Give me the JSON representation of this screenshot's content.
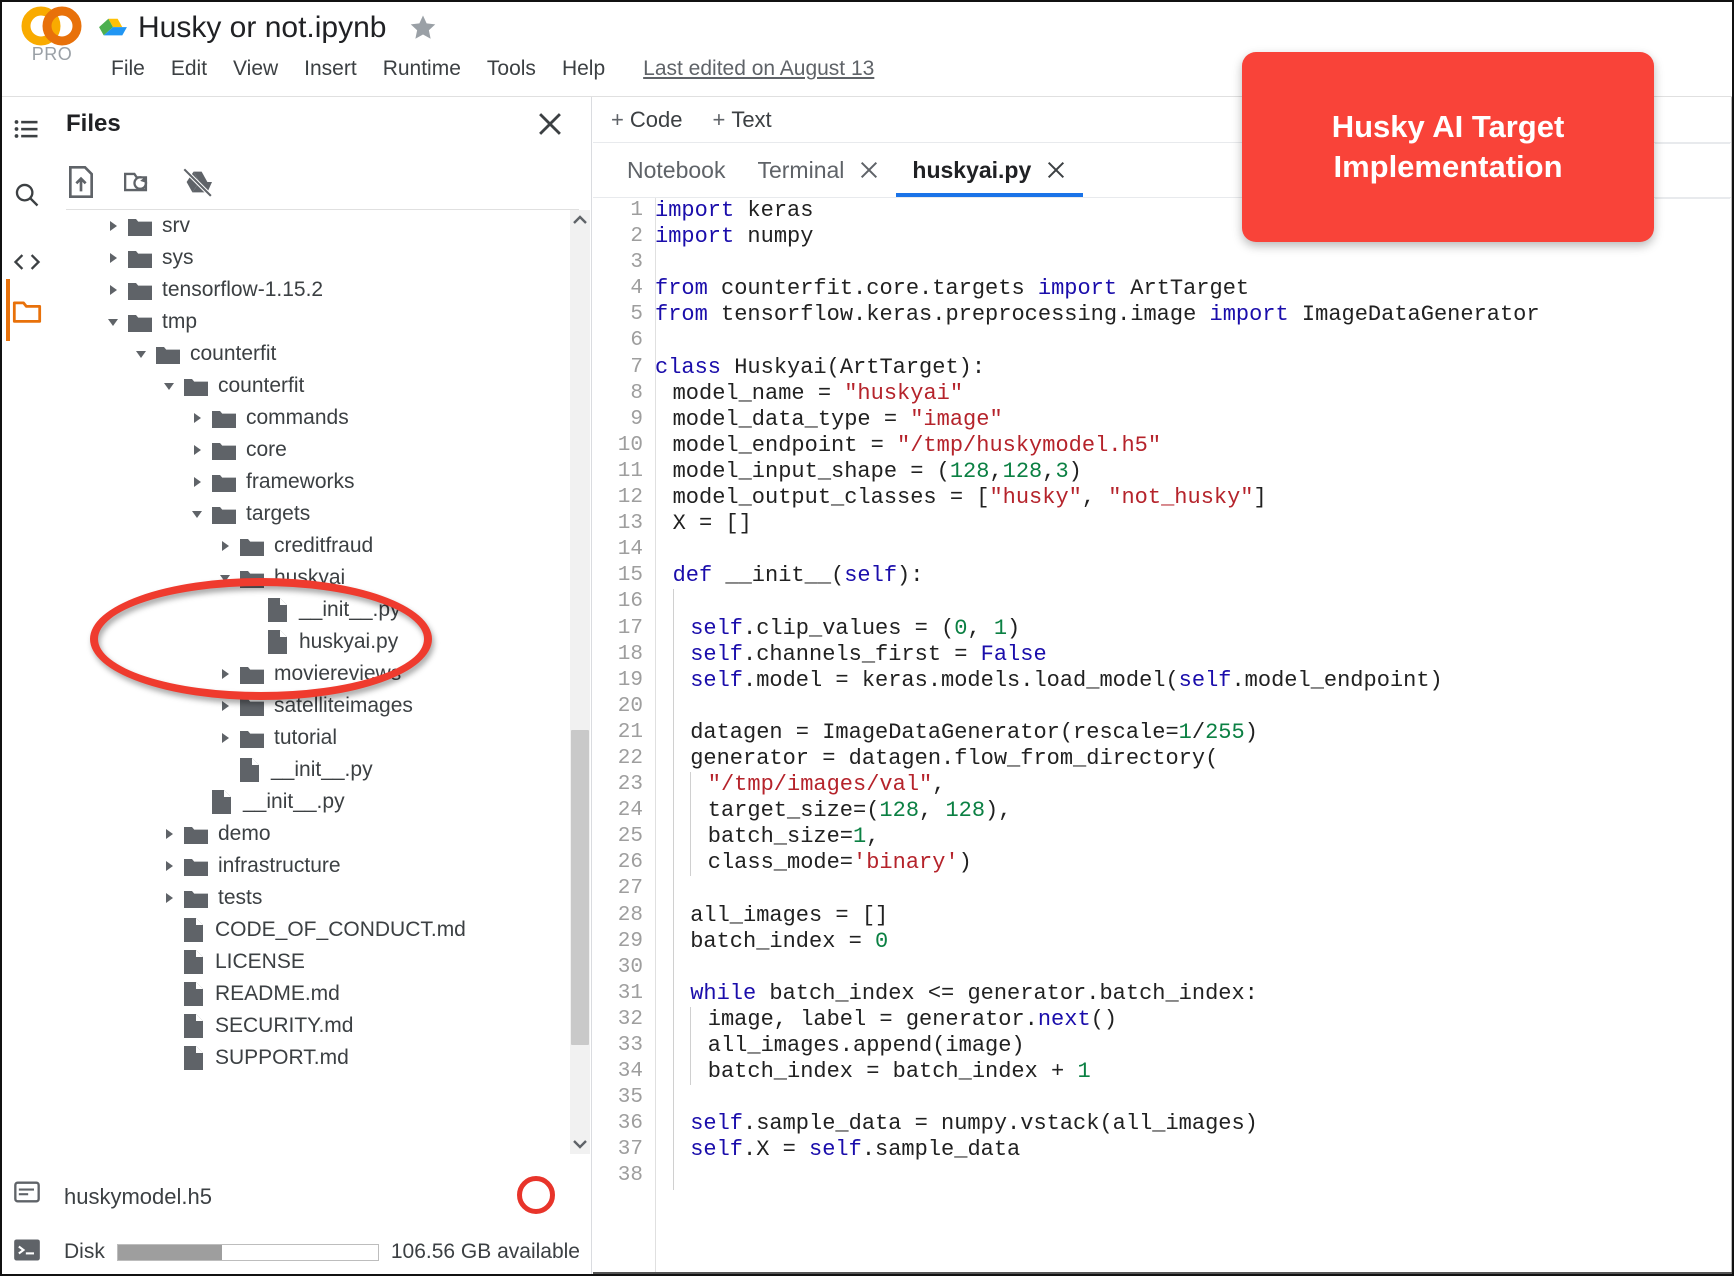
{
  "header": {
    "logo_label": "PRO",
    "doc_title": "Husky or not.ipynb",
    "menus": [
      "File",
      "Edit",
      "View",
      "Insert",
      "Runtime",
      "Tools",
      "Help"
    ],
    "last_edited": "Last edited on August 13"
  },
  "rail": {
    "items": [
      {
        "name": "table-of-contents-icon",
        "label": "Table of contents"
      },
      {
        "name": "search-icon",
        "label": "Search"
      },
      {
        "name": "code-snippets-icon",
        "label": "Code snippets"
      },
      {
        "name": "files-icon",
        "label": "Files",
        "active": true
      }
    ]
  },
  "files_panel": {
    "title": "Files",
    "close_label": "Close",
    "toolbar": [
      {
        "name": "upload-icon",
        "label": "Upload to session storage"
      },
      {
        "name": "refresh-folder-icon",
        "label": "Refresh"
      },
      {
        "name": "mount-drive-off-icon",
        "label": "Mount Drive"
      }
    ],
    "tree": [
      {
        "label": "srv",
        "type": "folder",
        "depth": 0,
        "state": "collapsed"
      },
      {
        "label": "sys",
        "type": "folder",
        "depth": 0,
        "state": "collapsed"
      },
      {
        "label": "tensorflow-1.15.2",
        "type": "folder",
        "depth": 0,
        "state": "collapsed"
      },
      {
        "label": "tmp",
        "type": "folder",
        "depth": 0,
        "state": "expanded"
      },
      {
        "label": "counterfit",
        "type": "folder",
        "depth": 1,
        "state": "expanded"
      },
      {
        "label": "counterfit",
        "type": "folder",
        "depth": 2,
        "state": "expanded"
      },
      {
        "label": "commands",
        "type": "folder",
        "depth": 3,
        "state": "collapsed"
      },
      {
        "label": "core",
        "type": "folder",
        "depth": 3,
        "state": "collapsed"
      },
      {
        "label": "frameworks",
        "type": "folder",
        "depth": 3,
        "state": "collapsed"
      },
      {
        "label": "targets",
        "type": "folder",
        "depth": 3,
        "state": "expanded"
      },
      {
        "label": "creditfraud",
        "type": "folder",
        "depth": 4,
        "state": "collapsed"
      },
      {
        "label": "huskyai",
        "type": "folder",
        "depth": 4,
        "state": "expanded"
      },
      {
        "label": "__init__.py",
        "type": "file",
        "depth": 5,
        "state": "none"
      },
      {
        "label": "huskyai.py",
        "type": "file",
        "depth": 5,
        "state": "none"
      },
      {
        "label": "moviereviews",
        "type": "folder",
        "depth": 4,
        "state": "collapsed"
      },
      {
        "label": "satelliteimages",
        "type": "folder",
        "depth": 4,
        "state": "collapsed"
      },
      {
        "label": "tutorial",
        "type": "folder",
        "depth": 4,
        "state": "collapsed"
      },
      {
        "label": "__init__.py",
        "type": "file",
        "depth": 4,
        "state": "none"
      },
      {
        "label": "__init__.py",
        "type": "file",
        "depth": 3,
        "state": "none"
      },
      {
        "label": "demo",
        "type": "folder",
        "depth": 2,
        "state": "collapsed"
      },
      {
        "label": "infrastructure",
        "type": "folder",
        "depth": 2,
        "state": "collapsed"
      },
      {
        "label": "tests",
        "type": "folder",
        "depth": 2,
        "state": "collapsed"
      },
      {
        "label": "CODE_OF_CONDUCT.md",
        "type": "file",
        "depth": 2,
        "state": "none"
      },
      {
        "label": "LICENSE",
        "type": "file",
        "depth": 2,
        "state": "none"
      },
      {
        "label": "README.md",
        "type": "file",
        "depth": 2,
        "state": "none"
      },
      {
        "label": "SECURITY.md",
        "type": "file",
        "depth": 2,
        "state": "none"
      },
      {
        "label": "SUPPORT.md",
        "type": "file",
        "depth": 2,
        "state": "none"
      }
    ],
    "status": {
      "selected_file": "huskymodel.h5",
      "disk_label": "Disk",
      "disk_available": "106.56 GB available",
      "disk_used_percent": 40
    }
  },
  "editor": {
    "cell_buttons": [
      {
        "plus": "+",
        "label": "Code"
      },
      {
        "plus": "+",
        "label": "Text"
      }
    ],
    "tabs": [
      {
        "label": "Notebook",
        "closable": false,
        "active": false
      },
      {
        "label": "Terminal",
        "closable": true,
        "active": false
      },
      {
        "label": "huskyai.py",
        "closable": true,
        "active": true
      }
    ],
    "code_lines": [
      {
        "n": 1,
        "indent": 0,
        "tokens": [
          {
            "t": "import",
            "c": "k"
          },
          {
            "t": " keras",
            "c": ""
          }
        ]
      },
      {
        "n": 2,
        "indent": 0,
        "tokens": [
          {
            "t": "import",
            "c": "k"
          },
          {
            "t": " numpy",
            "c": ""
          }
        ]
      },
      {
        "n": 3,
        "indent": 0,
        "tokens": []
      },
      {
        "n": 4,
        "indent": 0,
        "tokens": [
          {
            "t": "from",
            "c": "k"
          },
          {
            "t": " counterfit.core.targets ",
            "c": ""
          },
          {
            "t": "import",
            "c": "k"
          },
          {
            "t": " ArtTarget",
            "c": ""
          }
        ]
      },
      {
        "n": 5,
        "indent": 0,
        "tokens": [
          {
            "t": "from",
            "c": "k"
          },
          {
            "t": " tensorflow.keras.preprocessing.image ",
            "c": ""
          },
          {
            "t": "import",
            "c": "k"
          },
          {
            "t": " ImageDataGenerator",
            "c": ""
          }
        ]
      },
      {
        "n": 6,
        "indent": 0,
        "tokens": []
      },
      {
        "n": 7,
        "indent": 0,
        "tokens": [
          {
            "t": "class",
            "c": "k"
          },
          {
            "t": " Huskyai(ArtTarget):",
            "c": ""
          }
        ]
      },
      {
        "n": 8,
        "indent": 1,
        "tokens": [
          {
            "t": "model_name = ",
            "c": ""
          },
          {
            "t": "\"huskyai\"",
            "c": "s"
          }
        ]
      },
      {
        "n": 9,
        "indent": 1,
        "tokens": [
          {
            "t": "model_data_type = ",
            "c": ""
          },
          {
            "t": "\"image\"",
            "c": "s"
          }
        ]
      },
      {
        "n": 10,
        "indent": 1,
        "tokens": [
          {
            "t": "model_endpoint = ",
            "c": ""
          },
          {
            "t": "\"/tmp/huskymodel.h5\"",
            "c": "s"
          }
        ]
      },
      {
        "n": 11,
        "indent": 1,
        "tokens": [
          {
            "t": "model_input_shape = (",
            "c": ""
          },
          {
            "t": "128",
            "c": "n"
          },
          {
            "t": ",",
            "c": ""
          },
          {
            "t": "128",
            "c": "n"
          },
          {
            "t": ",",
            "c": ""
          },
          {
            "t": "3",
            "c": "n"
          },
          {
            "t": ")",
            "c": ""
          }
        ]
      },
      {
        "n": 12,
        "indent": 1,
        "tokens": [
          {
            "t": "model_output_classes = [",
            "c": ""
          },
          {
            "t": "\"husky\"",
            "c": "s"
          },
          {
            "t": ", ",
            "c": ""
          },
          {
            "t": "\"not_husky\"",
            "c": "s"
          },
          {
            "t": "]",
            "c": ""
          }
        ]
      },
      {
        "n": 13,
        "indent": 1,
        "tokens": [
          {
            "t": "X = []",
            "c": ""
          }
        ]
      },
      {
        "n": 14,
        "indent": 1,
        "tokens": []
      },
      {
        "n": 15,
        "indent": 1,
        "tokens": [
          {
            "t": "def",
            "c": "k"
          },
          {
            "t": " __init__(",
            "c": ""
          },
          {
            "t": "self",
            "c": "b"
          },
          {
            "t": "):",
            "c": ""
          }
        ]
      },
      {
        "n": 16,
        "indent": 2,
        "tokens": []
      },
      {
        "n": 17,
        "indent": 2,
        "tokens": [
          {
            "t": "self",
            "c": "b"
          },
          {
            "t": ".clip_values = (",
            "c": ""
          },
          {
            "t": "0",
            "c": "n"
          },
          {
            "t": ", ",
            "c": ""
          },
          {
            "t": "1",
            "c": "n"
          },
          {
            "t": ")",
            "c": ""
          }
        ]
      },
      {
        "n": 18,
        "indent": 2,
        "tokens": [
          {
            "t": "self",
            "c": "b"
          },
          {
            "t": ".channels_first = ",
            "c": ""
          },
          {
            "t": "False",
            "c": "k"
          }
        ]
      },
      {
        "n": 19,
        "indent": 2,
        "tokens": [
          {
            "t": "self",
            "c": "b"
          },
          {
            "t": ".model = keras.models.load_model(",
            "c": ""
          },
          {
            "t": "self",
            "c": "b"
          },
          {
            "t": ".model_endpoint)",
            "c": ""
          }
        ]
      },
      {
        "n": 20,
        "indent": 2,
        "tokens": []
      },
      {
        "n": 21,
        "indent": 2,
        "tokens": [
          {
            "t": "datagen = ImageDataGenerator(rescale=",
            "c": ""
          },
          {
            "t": "1",
            "c": "n"
          },
          {
            "t": "/",
            "c": ""
          },
          {
            "t": "255",
            "c": "n"
          },
          {
            "t": ")",
            "c": ""
          }
        ]
      },
      {
        "n": 22,
        "indent": 2,
        "tokens": [
          {
            "t": "generator = datagen.flow_from_directory(",
            "c": ""
          }
        ]
      },
      {
        "n": 23,
        "indent": 3,
        "tokens": [
          {
            "t": "\"/tmp/images/val\"",
            "c": "s"
          },
          {
            "t": ",",
            "c": ""
          }
        ]
      },
      {
        "n": 24,
        "indent": 3,
        "tokens": [
          {
            "t": "target_size=(",
            "c": ""
          },
          {
            "t": "128",
            "c": "n"
          },
          {
            "t": ", ",
            "c": ""
          },
          {
            "t": "128",
            "c": "n"
          },
          {
            "t": "),",
            "c": ""
          }
        ]
      },
      {
        "n": 25,
        "indent": 3,
        "tokens": [
          {
            "t": "batch_size=",
            "c": ""
          },
          {
            "t": "1",
            "c": "n"
          },
          {
            "t": ",",
            "c": ""
          }
        ]
      },
      {
        "n": 26,
        "indent": 3,
        "tokens": [
          {
            "t": "class_mode=",
            "c": ""
          },
          {
            "t": "'binary'",
            "c": "s"
          },
          {
            "t": ")",
            "c": ""
          }
        ]
      },
      {
        "n": 27,
        "indent": 2,
        "tokens": []
      },
      {
        "n": 28,
        "indent": 2,
        "tokens": [
          {
            "t": "all_images = []",
            "c": ""
          }
        ]
      },
      {
        "n": 29,
        "indent": 2,
        "tokens": [
          {
            "t": "batch_index = ",
            "c": ""
          },
          {
            "t": "0",
            "c": "n"
          }
        ]
      },
      {
        "n": 30,
        "indent": 2,
        "tokens": []
      },
      {
        "n": 31,
        "indent": 2,
        "tokens": [
          {
            "t": "while",
            "c": "k"
          },
          {
            "t": " batch_index <= generator.batch_index:",
            "c": ""
          }
        ]
      },
      {
        "n": 32,
        "indent": 3,
        "tokens": [
          {
            "t": "image, label = generator.",
            "c": ""
          },
          {
            "t": "next",
            "c": "b"
          },
          {
            "t": "()",
            "c": ""
          }
        ]
      },
      {
        "n": 33,
        "indent": 3,
        "tokens": [
          {
            "t": "all_images.append(image)",
            "c": ""
          }
        ]
      },
      {
        "n": 34,
        "indent": 3,
        "tokens": [
          {
            "t": "batch_index = batch_index + ",
            "c": ""
          },
          {
            "t": "1",
            "c": "n"
          }
        ]
      },
      {
        "n": 35,
        "indent": 2,
        "tokens": []
      },
      {
        "n": 36,
        "indent": 2,
        "tokens": [
          {
            "t": "self",
            "c": "b"
          },
          {
            "t": ".sample_data = numpy.vstack(all_images)",
            "c": ""
          }
        ]
      },
      {
        "n": 37,
        "indent": 2,
        "tokens": [
          {
            "t": "self",
            "c": "b"
          },
          {
            "t": ".X = ",
            "c": ""
          },
          {
            "t": "self",
            "c": "b"
          },
          {
            "t": ".sample_data",
            "c": ""
          }
        ]
      },
      {
        "n": 38,
        "indent": 2,
        "tokens": []
      }
    ]
  },
  "annotations": {
    "callout_text": "Husky AI Target Implementation",
    "callout_color": "#f94339",
    "ellipse_color": "#ef3b2e",
    "circle_color": "#e8342a"
  }
}
